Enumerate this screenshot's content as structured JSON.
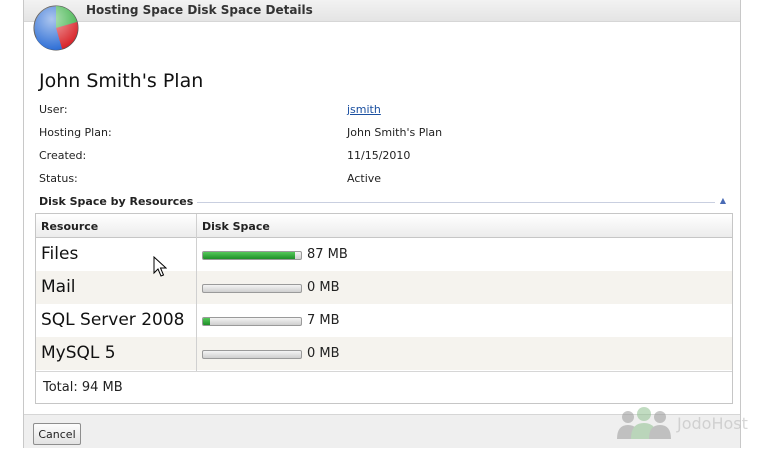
{
  "window": {
    "title": "Hosting Space Disk Space Details"
  },
  "plan": {
    "title": "John Smith's Plan"
  },
  "info": [
    {
      "label": "User:",
      "value": "jsmith"
    },
    {
      "label": "Hosting Plan:",
      "value": "John Smith's Plan"
    },
    {
      "label": "Created:",
      "value": "11/15/2010"
    },
    {
      "label": "Status:",
      "value": "Active"
    }
  ],
  "section": {
    "title": "Disk Space by Resources",
    "collapse_icon": "collapse-up-icon"
  },
  "grid": {
    "headers": [
      "Resource",
      "Disk Space"
    ],
    "rows": [
      {
        "name": "Files",
        "value": "87 MB",
        "fill": 0.94
      },
      {
        "name": "Mail",
        "value": "0 MB",
        "fill": 0
      },
      {
        "name": "SQL Server 2008",
        "value": "7 MB",
        "fill": 0.07
      },
      {
        "name": "MySQL 5",
        "value": "0 MB",
        "fill": 0
      }
    ],
    "total": "Total: 94 MB"
  },
  "footer": {
    "cancel_label": "Cancel"
  },
  "watermark": {
    "text": "JodoHost"
  },
  "colors": {
    "bar_fill": "#2ea236",
    "link": "#1a4fa0",
    "alt_row": "#f5f3ee"
  }
}
